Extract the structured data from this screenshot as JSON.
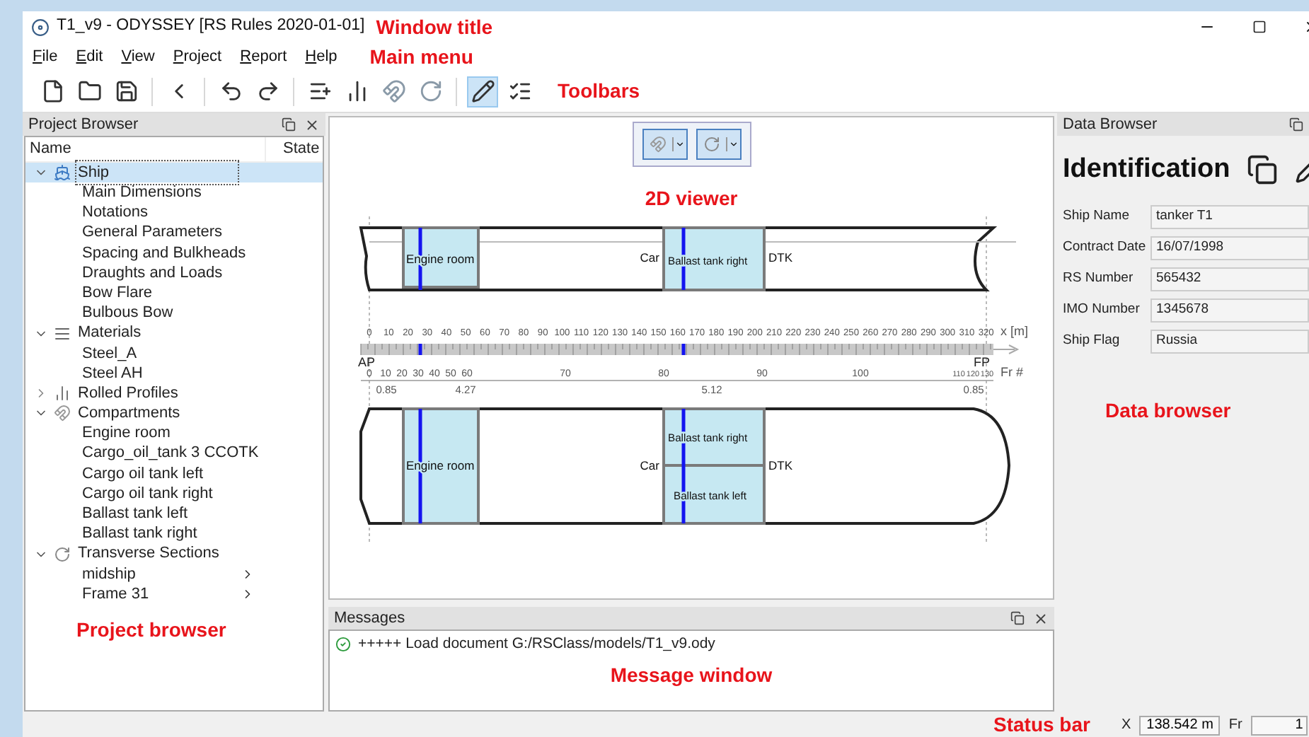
{
  "window": {
    "title": "T1_v9 - ODYSSEY [RS Rules 2020-01-01]",
    "callout": "Window title"
  },
  "menu": {
    "items": [
      "File",
      "Edit",
      "View",
      "Project",
      "Report",
      "Help"
    ],
    "callout": "Main menu"
  },
  "toolbar": {
    "items": [
      {
        "kind": "new",
        "selected": false
      },
      {
        "kind": "open",
        "selected": false
      },
      {
        "kind": "save",
        "selected": false
      },
      {
        "kind": "back",
        "selected": false
      },
      {
        "kind": "undo",
        "selected": false
      },
      {
        "kind": "redo",
        "selected": false
      },
      {
        "kind": "add-material",
        "selected": false
      },
      {
        "kind": "add-profile",
        "selected": false
      },
      {
        "kind": "add-compartment",
        "selected": false
      },
      {
        "kind": "add-section",
        "selected": false
      },
      {
        "kind": "edit",
        "selected": true
      },
      {
        "kind": "checklist",
        "selected": false
      }
    ],
    "callout": "Toolbars"
  },
  "project_browser": {
    "title": "Project Browser",
    "columns": [
      "Name",
      "State"
    ],
    "callout": "Project browser",
    "tree": [
      {
        "label": "Ship",
        "kind": "ship",
        "expanded": true,
        "selected": true,
        "children": [
          {
            "label": "Main Dimensions",
            "selected": false
          },
          {
            "label": "Notations",
            "selected": false
          },
          {
            "label": "General Parameters",
            "selected": false
          },
          {
            "label": "Spacing and Bulkheads",
            "selected": false
          },
          {
            "label": "Draughts and Loads",
            "selected": false
          },
          {
            "label": "Bow Flare",
            "selected": false
          },
          {
            "label": "Bulbous Bow",
            "selected": false
          }
        ]
      },
      {
        "label": "Materials",
        "kind": "materials",
        "expanded": true,
        "selected": false,
        "children": [
          {
            "label": "Steel_A",
            "selected": false
          },
          {
            "label": "Steel AH",
            "selected": false
          }
        ]
      },
      {
        "label": "Rolled Profiles",
        "kind": "profiles",
        "expanded": false,
        "selected": false
      },
      {
        "label": "Compartments",
        "kind": "compartments",
        "expanded": true,
        "selected": false,
        "children": [
          {
            "label": "Engine room",
            "selected": false
          },
          {
            "label": "Cargo_oil_tank 3 CCOTK",
            "selected": false
          },
          {
            "label": "Cargo oil tank left",
            "selected": false
          },
          {
            "label": "Cargo oil tank right",
            "selected": false
          },
          {
            "label": "Ballast tank left",
            "selected": false
          },
          {
            "label": "Ballast tank right",
            "selected": false
          }
        ]
      },
      {
        "label": "Transverse Sections",
        "kind": "sections",
        "expanded": true,
        "selected": false,
        "children": [
          {
            "label": "midship",
            "selected": false,
            "expandable": true
          },
          {
            "label": "Frame 31",
            "selected": false,
            "expandable": true
          }
        ]
      }
    ]
  },
  "viewer": {
    "callout": "2D viewer",
    "profile_labels": [
      "Engine room",
      "Car",
      "Ballast tank right",
      "DTK"
    ],
    "x_scale": {
      "labels": [
        "0",
        "10",
        "20",
        "30",
        "40",
        "50",
        "60",
        "70",
        "80",
        "90",
        "100",
        "110",
        "120",
        "130",
        "140",
        "150",
        "160",
        "170",
        "180",
        "190",
        "200",
        "210",
        "220",
        "230",
        "240",
        "250",
        "260",
        "270",
        "280",
        "290",
        "300",
        "310",
        "320"
      ],
      "unit": "x [m]"
    },
    "ends": [
      "AP",
      "FP"
    ],
    "frame_scale": {
      "labels": [
        "0",
        "10",
        "20",
        "30",
        "40",
        "50",
        "60",
        "70",
        "80",
        "90",
        "100",
        "110",
        "120",
        "130"
      ],
      "unit": "Fr #"
    },
    "spacings": [
      "0.85",
      "4.27",
      "5.12",
      "0.85"
    ],
    "plan_labels": [
      "Engine room",
      "Car",
      "Ballast tank right",
      "Ballast tank left",
      "DTK"
    ]
  },
  "messages": {
    "title": "Messages",
    "callout": "Message window",
    "entries": [
      {
        "kind": "success",
        "text": "+++++ Load document G:/RSClass/models/T1_v9.ody"
      }
    ]
  },
  "data_browser": {
    "title": "Data Browser",
    "heading": "Identification",
    "callout": "Data browser",
    "fields": [
      {
        "label": "Ship Name",
        "value": "tanker T1"
      },
      {
        "label": "Contract Date",
        "value": "16/07/1998"
      },
      {
        "label": "RS Number",
        "value": "565432"
      },
      {
        "label": "IMO Number",
        "value": "1345678"
      },
      {
        "label": "Ship Flag",
        "value": "Russia"
      }
    ]
  },
  "status_bar": {
    "callout": "Status bar",
    "x_label": "X",
    "x_value": "138.542 m",
    "fr_label": "Fr",
    "fr_value": "1"
  }
}
